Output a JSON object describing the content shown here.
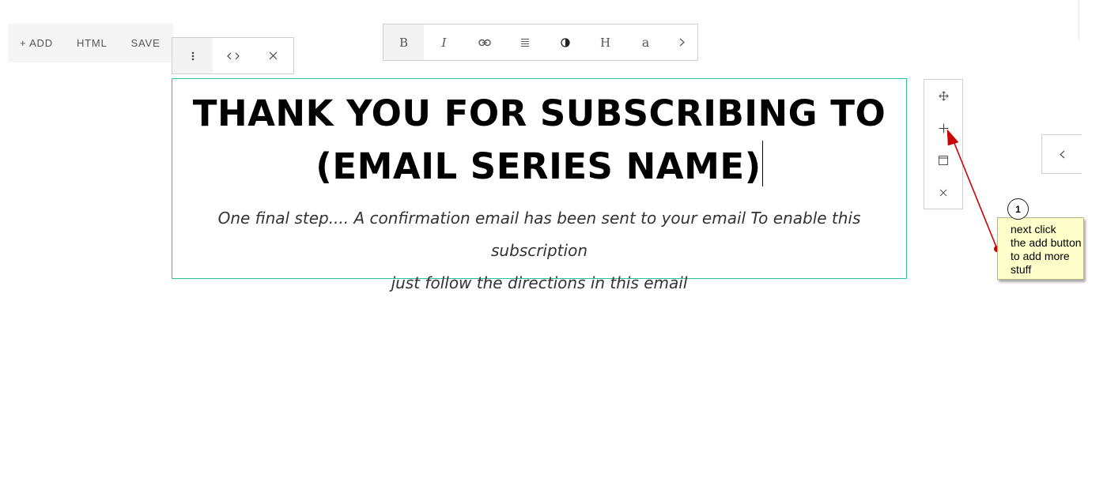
{
  "top_toolbar": {
    "add_label": "+ ADD",
    "html_label": "HTML",
    "save_label": "SAVE"
  },
  "block_toolbar": {
    "icons": [
      "more-vertical-icon",
      "code-icon",
      "close-icon"
    ]
  },
  "format_toolbar": {
    "bold_label": "B",
    "italic_label": "I",
    "heading_label": "H",
    "font_label": "a",
    "icons": [
      "bold-icon",
      "italic-icon",
      "link-icon",
      "align-icon",
      "color-contrast-icon",
      "heading-icon",
      "font-icon",
      "chevron-right-icon"
    ]
  },
  "content": {
    "headline_line1": "THANK YOU FOR SUBSCRIBING TO",
    "headline_line2": "(EMAIL SERIES NAME)",
    "subtext_line1": "One final step.... A confirmation email has been sent to your email To enable this subscription",
    "subtext_line2": "just follow the directions in this email",
    "accent_color": "#2bbf9c"
  },
  "side_toolbar": {
    "icons": [
      "move-icon",
      "plus-icon",
      "duplicate-icon",
      "close-icon"
    ]
  },
  "collapse_panel": {
    "icon": "chevron-left-icon"
  },
  "annotation": {
    "number": "1",
    "text": "next click\nthe add button\nto add more\nstuff",
    "arrow_color": "#cc0000",
    "callout_bg": "#ffffcc"
  }
}
